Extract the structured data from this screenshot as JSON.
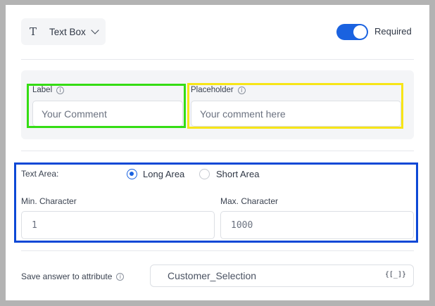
{
  "header": {
    "field_type_icon": "T",
    "field_type_label": "Text Box",
    "required_label": "Required",
    "required_on": true
  },
  "label_field": {
    "label": "Label",
    "info_icon": "i",
    "value": "Your Comment"
  },
  "placeholder_field": {
    "label": "Placeholder",
    "info_icon": "i",
    "value": "Your comment here"
  },
  "text_area": {
    "label": "Text Area:",
    "options": [
      {
        "label": "Long Area",
        "selected": true
      },
      {
        "label": "Short Area",
        "selected": false
      }
    ],
    "min_label": "Min. Character",
    "min_value": "1",
    "max_label": "Max. Character",
    "max_value": "1000"
  },
  "attribute": {
    "label": "Save answer to attribute",
    "info_icon": "i",
    "value": "Customer_Selection",
    "var_icon": "{[_]}"
  },
  "colors": {
    "accent": "#1a62e0",
    "highlight_green": "#35dd14",
    "highlight_yellow": "#f7e517",
    "highlight_blue": "#0d48d6"
  }
}
